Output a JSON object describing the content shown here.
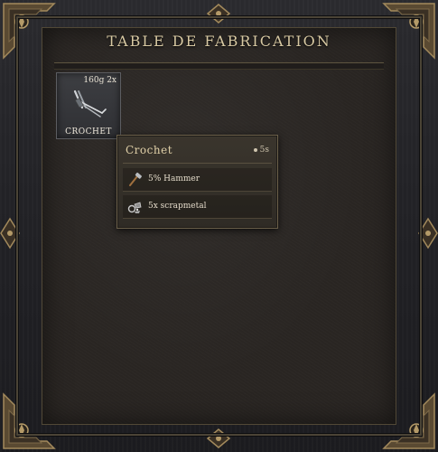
{
  "window": {
    "title": "TABLE DE FABRICATION"
  },
  "recipe_slot": {
    "badge": "160g 2x",
    "label": "CROCHET",
    "icon": "lockpick-icon"
  },
  "tooltip": {
    "title": "Crochet",
    "time": "5s",
    "requirements": [
      {
        "text": "5% Hammer",
        "icon": "hammer-icon"
      },
      {
        "text": "5x scrapmetal",
        "icon": "scrapmetal-icon"
      }
    ]
  },
  "colors": {
    "accent": "#d8c9a3",
    "panel": "#2a2623",
    "frame": "#2b2b2f",
    "brass": "#8a7652"
  }
}
